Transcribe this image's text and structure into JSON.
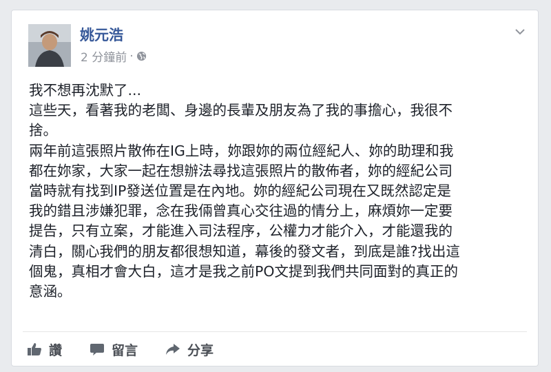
{
  "post": {
    "author": "姚元浩",
    "timestamp": "2 分鐘前",
    "separator": "·",
    "lines": [
      "我不想再沈默了...",
      "這些天，看著我的老闆、身邊的長輩及朋友為了我的事擔心，我很不",
      "捨。",
      "兩年前這張照片散佈在IG上時，妳跟妳的兩位經紀人、妳的助理和我",
      "都在妳家，大家一起在想辦法尋找這張照片的散佈者，妳的經紀公司",
      "當時就有找到IP發送位置是在內地。妳的經紀公司現在又既然認定是",
      "我的錯且涉嫌犯罪，念在我倆曾真心交往過的情分上，麻煩妳一定要",
      "提告，只有立案，才能進入司法程序，公權力才能介入，才能還我的",
      "清白，關心我們的朋友都很想知道，幕後的發文者，到底是誰?找出這",
      "個鬼，真相才會大白，這才是我之前PO文提到我們共同面對的真正的",
      "意涵。"
    ]
  },
  "actions": {
    "like": "讚",
    "comment": "留言",
    "share": "分享"
  },
  "icons": {
    "privacy": "globe-icon",
    "menu": "chevron-down-icon",
    "like": "thumbs-up-icon",
    "comment": "comment-bubble-icon",
    "share": "share-arrow-icon"
  },
  "colors": {
    "author_link": "#365899",
    "meta_text": "#90949c",
    "body_text": "#1d2129",
    "action_text": "#4b4f56"
  }
}
